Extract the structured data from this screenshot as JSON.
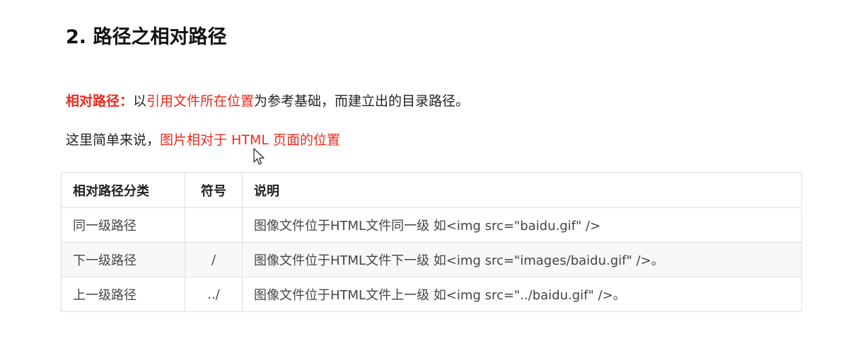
{
  "heading": "2. 路径之相对路径",
  "definition": {
    "label": "相对路径：",
    "text1": "以",
    "highlight": "引用文件所在位置",
    "text2": "为参考基础，而建立出的目录路径。"
  },
  "explanation": {
    "text": "这里简单来说，",
    "highlight": "图片相对于 HTML 页面的位置"
  },
  "table": {
    "headers": [
      "相对路径分类",
      "符号",
      "说明"
    ],
    "rows": [
      {
        "category": "同一级路径",
        "symbol": "",
        "description": "图像文件位于HTML文件同一级   如<img src=\"baidu.gif\" />"
      },
      {
        "category": "下一级路径",
        "symbol": "/",
        "description": "图像文件位于HTML文件下一级    如<img src=\"images/baidu.gif\" />。"
      },
      {
        "category": "上一级路径",
        "symbol": "../",
        "description": "图像文件位于HTML文件上一级    如<img src=\"../baidu.gif\" />。"
      }
    ]
  },
  "colors": {
    "accent": "#f2281b",
    "border": "#dfdfdf",
    "alt_row": "#f8f8f8"
  },
  "icons": {
    "cursor": "mouse-pointer-icon"
  }
}
